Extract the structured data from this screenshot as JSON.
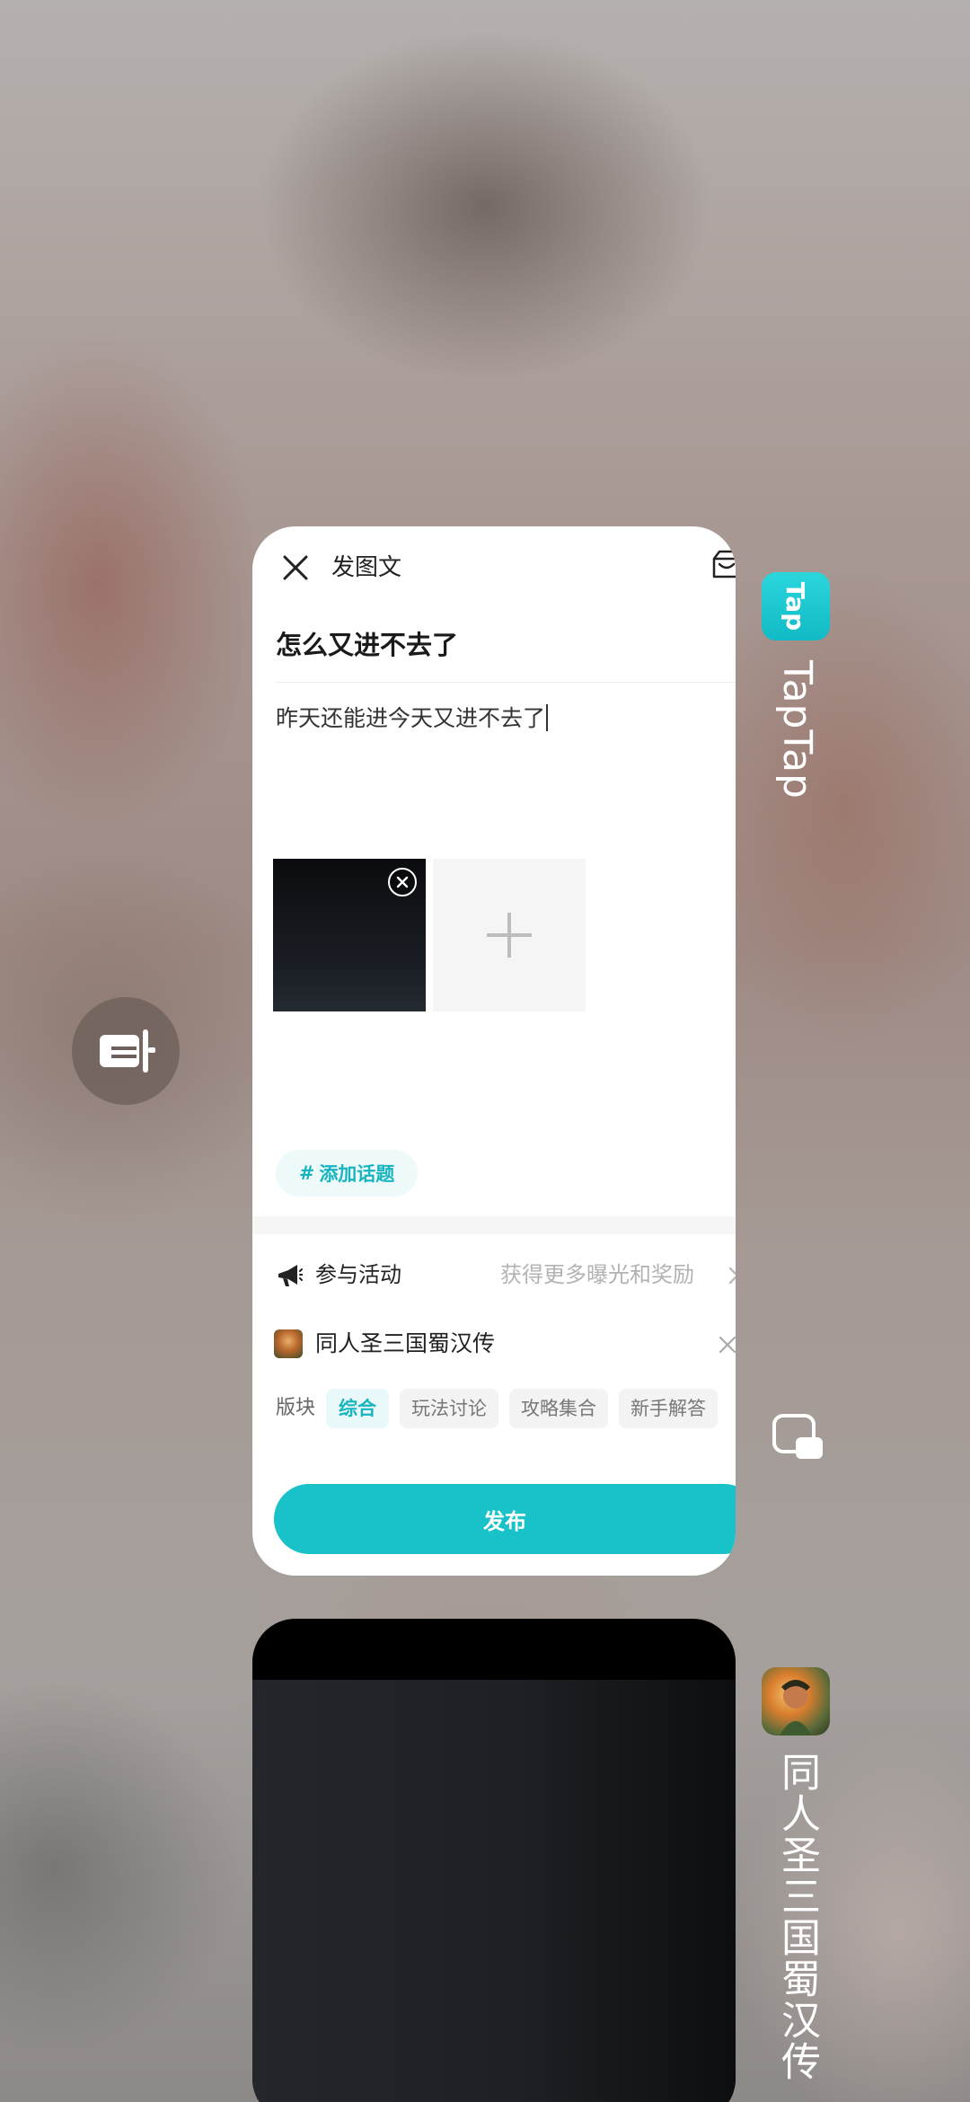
{
  "editor": {
    "header_title": "发图文",
    "post_title": "怎么又进不去了",
    "body_text": "昨天还能进今天又进不去了",
    "add_topic_label": "添加话题",
    "activity_label": "参与活动",
    "activity_hint": "获得更多曝光和奖励",
    "game_name": "同人圣三国蜀汉传",
    "section_label": "版块",
    "section_tabs": [
      "综合",
      "玩法讨论",
      "攻略集合",
      "新手解答"
    ],
    "active_section": "综合",
    "publish_label": "发布"
  },
  "recents": {
    "app1": {
      "name": "TapTap",
      "icon_text": "Tap"
    },
    "app2": {
      "name": "同人圣三国蜀汉传"
    }
  },
  "icons": {
    "close": "close-icon",
    "draft": "draft-box-icon",
    "remove_image": "remove-image-icon",
    "add_image": "plus-icon",
    "activity": "megaphone-icon",
    "chevron": "chevron-right-icon",
    "remove_game": "close-icon",
    "float": "floating-window-icon",
    "window": "small-window-icon"
  },
  "colors": {
    "accent": "#19c2c9",
    "accent_text": "#18b4bf",
    "card_bg": "#ffffff"
  }
}
